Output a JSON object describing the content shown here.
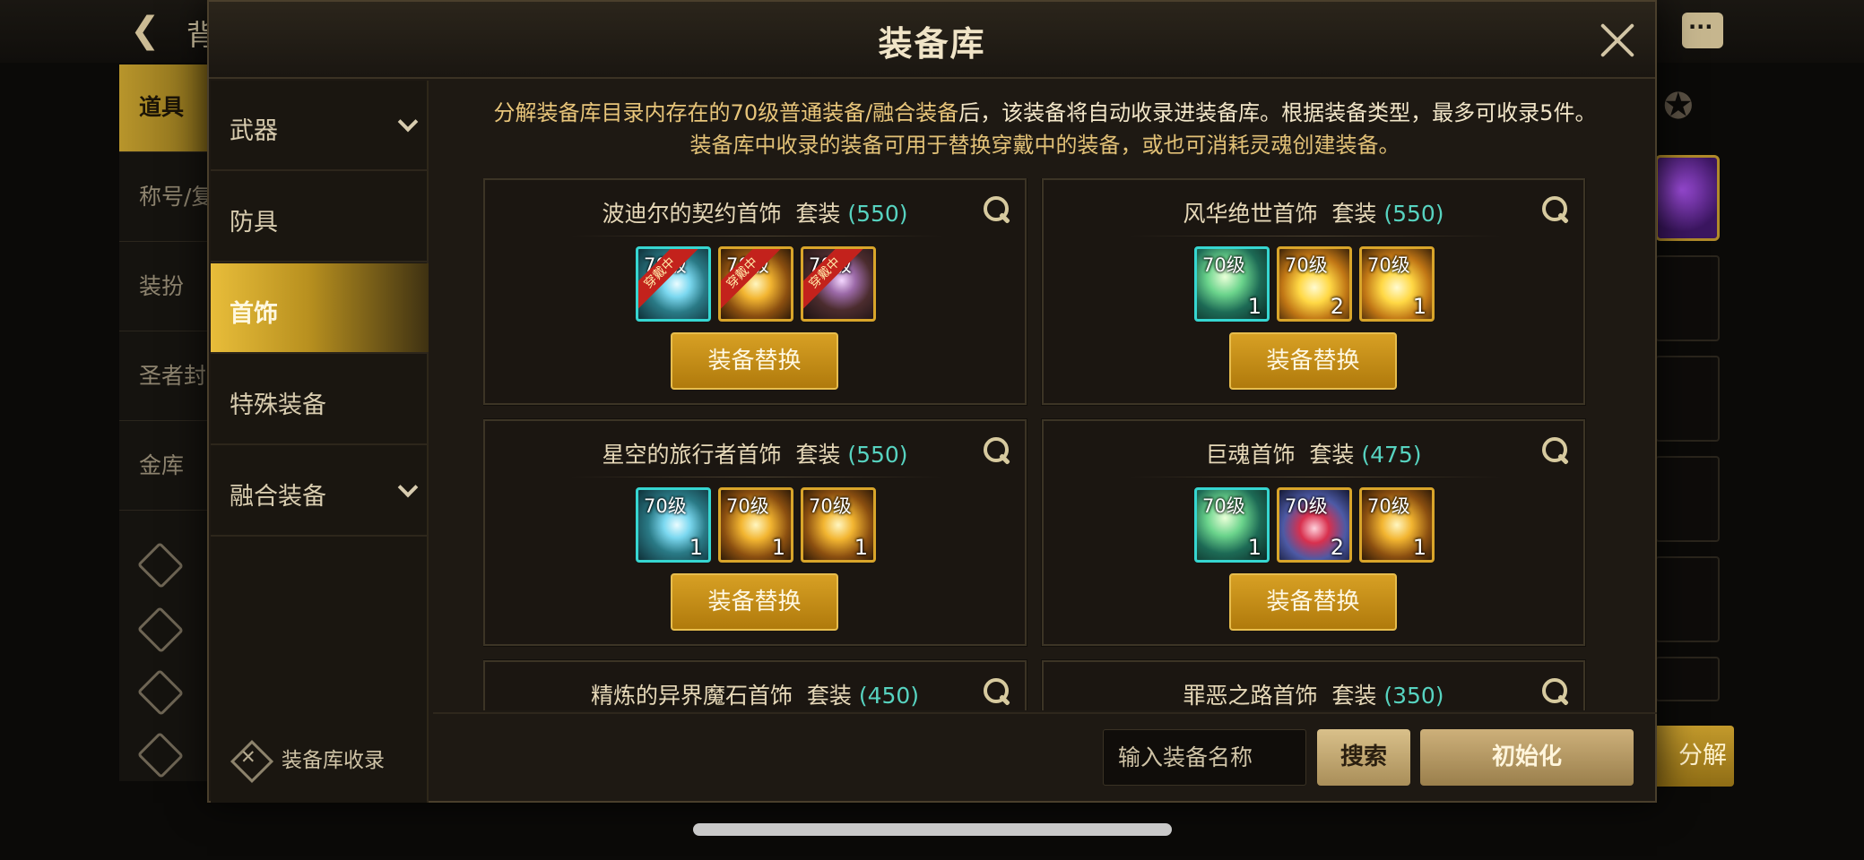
{
  "background": {
    "title": "背",
    "sidebar": [
      "道具",
      "称号/复",
      "装扮",
      "圣者封",
      "金库"
    ]
  },
  "modal": {
    "title": "装备库",
    "nav": [
      {
        "label": "武器",
        "expandable": true
      },
      {
        "label": "防具",
        "expandable": false
      },
      {
        "label": "首饰",
        "expandable": false,
        "active": true
      },
      {
        "label": "特殊装备",
        "expandable": false
      },
      {
        "label": "融合装备",
        "expandable": true
      }
    ],
    "nav_footer": "装备库收录",
    "notice": {
      "line1_a": "分解装备库目录内存在的70级普通装备/融合装备",
      "line1_b": "后，该装备将自动收录进装备库。根据装备类型，最多可收录5件。",
      "line2": "装备库中收录的装备可用于替换穿戴中的装备，或也可消耗灵魂创建装备。"
    },
    "swap_label": "装备替换",
    "cards": [
      {
        "name": "波迪尔的契约首饰",
        "suffix": "套装",
        "count": "(550)",
        "items": [
          {
            "level": "70级",
            "qty": "",
            "badge": "穿戴中",
            "color": "teal"
          },
          {
            "level": "70级",
            "qty": "",
            "badge": "穿戴中",
            "color": "gold"
          },
          {
            "level": "70级",
            "qty": "",
            "badge": "穿戴中",
            "color": "dark"
          }
        ]
      },
      {
        "name": "风华绝世首饰",
        "suffix": "套装",
        "count": "(550)",
        "items": [
          {
            "level": "70级",
            "qty": "1",
            "badge": "",
            "color": "green"
          },
          {
            "level": "70级",
            "qty": "2",
            "badge": "",
            "color": "star"
          },
          {
            "level": "70级",
            "qty": "1",
            "badge": "",
            "color": "star"
          }
        ]
      },
      {
        "name": "星空的旅行者首饰",
        "suffix": "套装",
        "count": "(550)",
        "items": [
          {
            "level": "70级",
            "qty": "1",
            "badge": "",
            "color": "teal"
          },
          {
            "level": "70级",
            "qty": "1",
            "badge": "",
            "color": "gold"
          },
          {
            "level": "70级",
            "qty": "1",
            "badge": "",
            "color": "gold"
          }
        ]
      },
      {
        "name": "巨魂首饰",
        "suffix": "套装",
        "count": "(475)",
        "items": [
          {
            "level": "70级",
            "qty": "1",
            "badge": "",
            "color": "green"
          },
          {
            "level": "70级",
            "qty": "2",
            "badge": "",
            "color": "ruby"
          },
          {
            "level": "70级",
            "qty": "1",
            "badge": "",
            "color": "gold"
          }
        ]
      },
      {
        "name": "精炼的异界魔石首饰",
        "suffix": "套装",
        "count": "(450)",
        "items": []
      },
      {
        "name": "罪恶之路首饰",
        "suffix": "套装",
        "count": "(350)",
        "items": []
      }
    ],
    "search": {
      "placeholder": "输入装备名称",
      "button": "搜索"
    },
    "reset_button": "初始化",
    "decompose_button": "分解"
  },
  "colors": {
    "accent": "#c9911a",
    "count": "#57d3c0",
    "panel": "#1e1913"
  }
}
